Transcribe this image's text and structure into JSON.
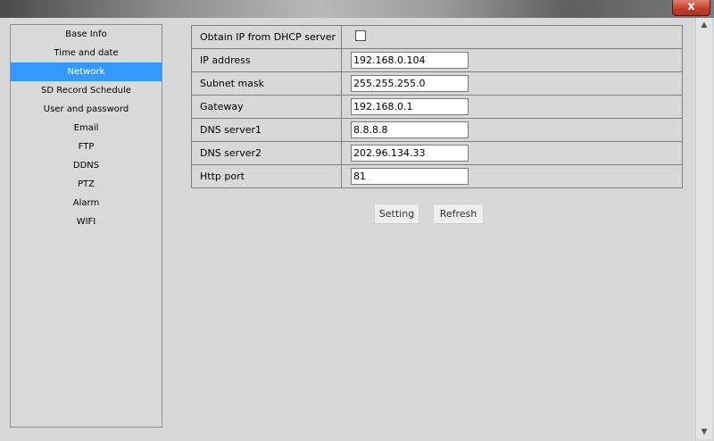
{
  "window": {
    "close_glyph": "x"
  },
  "sidebar": {
    "items": [
      {
        "label": "Base Info",
        "active": false
      },
      {
        "label": "Time and date",
        "active": false
      },
      {
        "label": "Network",
        "active": true
      },
      {
        "label": "SD Record Schedule",
        "active": false
      },
      {
        "label": "User and password",
        "active": false
      },
      {
        "label": "Email",
        "active": false
      },
      {
        "label": "FTP",
        "active": false
      },
      {
        "label": "DDNS",
        "active": false
      },
      {
        "label": "PTZ",
        "active": false
      },
      {
        "label": "Alarm",
        "active": false
      },
      {
        "label": "WIFI",
        "active": false
      }
    ]
  },
  "form": {
    "dhcp_label": "Obtain IP from DHCP server",
    "dhcp_checked": false,
    "ip_label": "IP address",
    "ip_value": "192.168.0.104",
    "subnet_label": "Subnet mask",
    "subnet_value": "255.255.255.0",
    "gateway_label": "Gateway",
    "gateway_value": "192.168.0.1",
    "dns1_label": "DNS server1",
    "dns1_value": "8.8.8.8",
    "dns2_label": "DNS server2",
    "dns2_value": "202.96.134.33",
    "port_label": "Http port",
    "port_value": "81"
  },
  "buttons": {
    "setting": "Setting",
    "refresh": "Refresh"
  },
  "scrollbar": {
    "up_glyph": "▲",
    "down_glyph": "▼"
  },
  "colors": {
    "selected_nav": "#3399ff",
    "close_button": "#c4402e"
  }
}
